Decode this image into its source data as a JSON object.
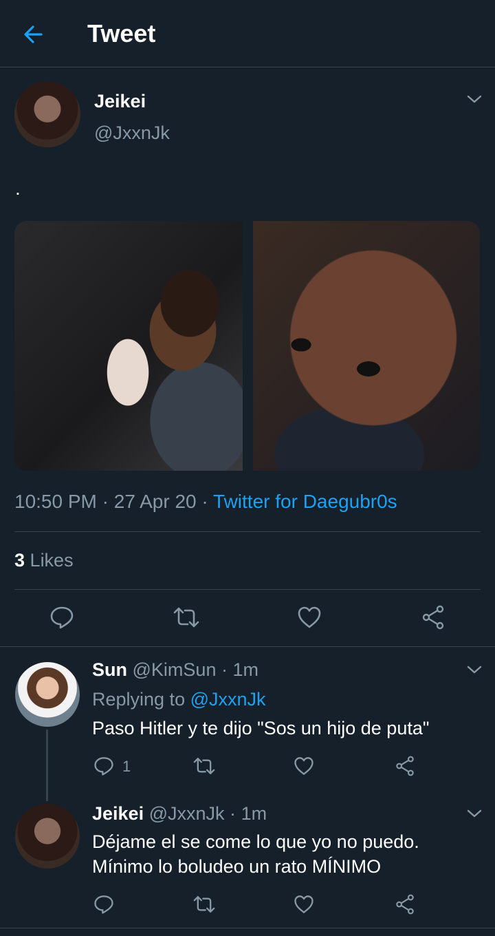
{
  "header": {
    "title": "Tweet"
  },
  "tweet": {
    "author_name": "Jeikei",
    "author_handle": "@JxxnJk",
    "text": ".",
    "time": "10:50 PM",
    "date": "27 Apr 20",
    "meta_sep": "·",
    "client": "Twitter for Daegubr0s",
    "likes_count": "3",
    "likes_label": "Likes"
  },
  "replies": [
    {
      "author_name": "Sun",
      "author_handle": "@KimSun",
      "time_sep": "·",
      "time": "1m",
      "replying_label": "Replying to",
      "replying_handle": "@JxxnJk",
      "text": "Paso Hitler y te dijo \"Sos un hijo de puta\"",
      "reply_count": "1"
    },
    {
      "author_name": "Jeikei",
      "author_handle": "@JxxnJk",
      "time_sep": "·",
      "time": "1m",
      "text_line1": "Déjame el se come lo que yo no puedo.",
      "text_line2": "Mínimo lo boludeo un rato MÍNIMO"
    }
  ],
  "icons": {
    "back": "arrow-left-icon",
    "chevron": "chevron-down-icon",
    "reply": "reply-icon",
    "retweet": "retweet-icon",
    "like": "heart-icon",
    "share": "share-icon"
  },
  "colors": {
    "background": "#15202b",
    "accent": "#1da1f2",
    "muted": "#8899a6",
    "border": "#38444d"
  }
}
